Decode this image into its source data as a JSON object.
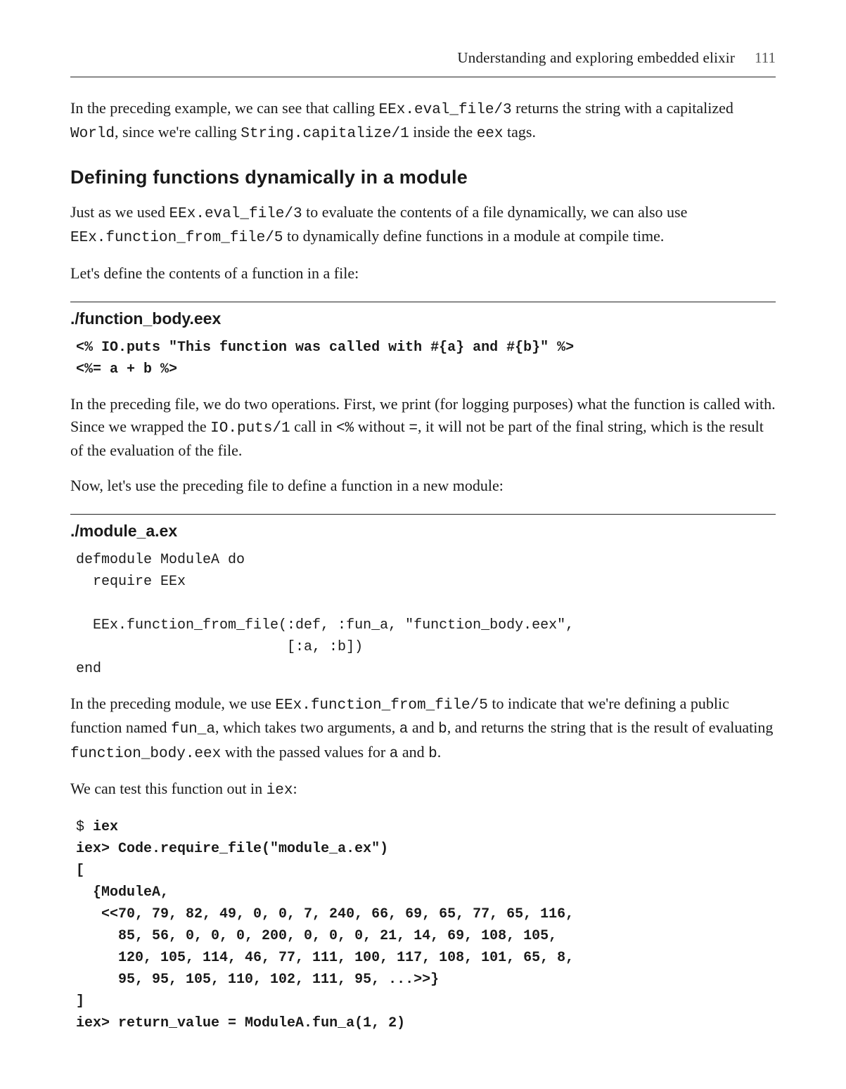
{
  "header": {
    "running_title": "Understanding and exploring embedded elixir",
    "page_number": "111"
  },
  "para1": {
    "a": "In the preceding example, we can see that calling ",
    "code1": "EEx.eval_file/3",
    "b": " returns the string with a capitalized ",
    "code2": "World",
    "c": ", since we're calling ",
    "code3": "String.capitalize/1",
    "d": " inside the ",
    "code4": "eex",
    "e": " tags."
  },
  "section_heading": "Defining functions dynamically in a module",
  "para2": {
    "a": "Just as we used ",
    "code1": "EEx.eval_file/3",
    "b": " to evaluate the contents of a file dynamically, we can also use ",
    "code2": "EEx.function_from_file/5",
    "c": " to dynamically define functions in a module at compile time."
  },
  "para3": "Let's define the contents of a function in a file:",
  "file1": {
    "name": "./function_body.eex",
    "code": "<% IO.puts \"This function was called with #{a} and #{b}\" %>\n<%= a + b %>"
  },
  "para4": {
    "a": "In the preceding file, we do two operations. First, we print (for logging purposes) what the function is called with. Since we wrapped the ",
    "code1": "IO.puts/1",
    "b": " call in ",
    "code2": "<%",
    "c": " without ",
    "code3": "=",
    "d": ", it will not be part of the final string, which is the result of the evaluation of the file."
  },
  "para5": "Now, let's use the preceding file to define a function in a new module:",
  "file2": {
    "name": "./module_a.ex",
    "code": "defmodule ModuleA do\n  require EEx\n\n  EEx.function_from_file(:def, :fun_a, \"function_body.eex\",\n                         [:a, :b])\nend"
  },
  "para6": {
    "a": "In the preceding module, we use ",
    "code1": "EEx.function_from_file/5",
    "b": " to indicate that we're defining a public function named ",
    "code2": "fun_a",
    "c": ", which takes two arguments, ",
    "code3": "a",
    "d": " and ",
    "code4": "b",
    "e": ", and returns the string that is the result of evaluating ",
    "code5": "function_body.eex",
    "f": " with the passed values for ",
    "code6": "a",
    "g": " and ",
    "code7": "b",
    "h": "."
  },
  "para7": {
    "a": "We can test this function out in ",
    "code1": "iex",
    "b": ":"
  },
  "iex": {
    "l1_prompt": "$ ",
    "l1_cmd": "iex",
    "l2_prompt": "iex> ",
    "l2_cmd": "Code.require_file(\"module_a.ex\")",
    "out": "[\n  {ModuleA,\n   <<70, 79, 82, 49, 0, 0, 7, 240, 66, 69, 65, 77, 65, 116,\n     85, 56, 0, 0, 0, 200, 0, 0, 0, 21, 14, 69, 108, 105,\n     120, 105, 114, 46, 77, 111, 100, 117, 108, 101, 65, 8,\n     95, 95, 105, 110, 102, 111, 95, ...>>}\n]",
    "l3_prompt": "iex> ",
    "l3_cmd": "return_value = ModuleA.fun_a(1, 2)"
  }
}
